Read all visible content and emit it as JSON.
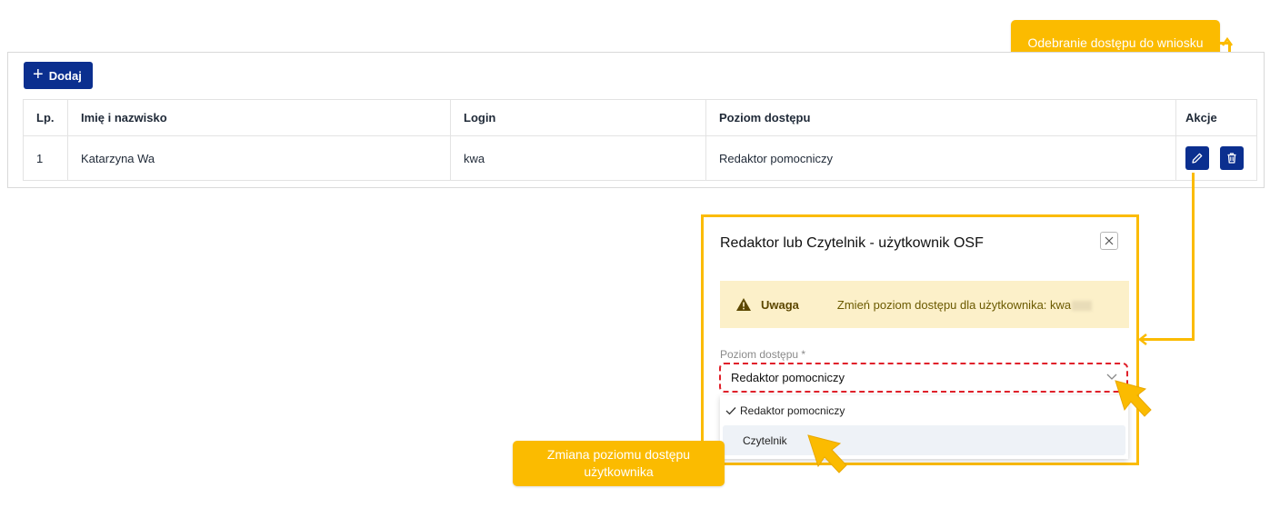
{
  "toolbar": {
    "add_label": "Dodaj"
  },
  "table": {
    "headers": {
      "lp": "Lp.",
      "name": "Imię i nazwisko",
      "login": "Login",
      "level": "Poziom dostępu",
      "actions": "Akcje"
    },
    "rows": [
      {
        "lp": "1",
        "name": "Katarzyna Wa",
        "login": "kwa",
        "level": "Redaktor pomocniczy"
      }
    ]
  },
  "callouts": {
    "remove_access": "Odebranie dostępu do wniosku",
    "change_level": "Zmiana poziomu dostępu użytkownika"
  },
  "modal": {
    "title": "Redaktor lub Czytelnik - użytkownik OSF",
    "alert_title": "Uwaga",
    "alert_message": "Zmień poziom dostępu dla użytkownika: kwa",
    "field_label": "Poziom dostępu *",
    "selected_value": "Redaktor pomocniczy",
    "options": [
      "Redaktor pomocniczy",
      "Czytelnik"
    ]
  },
  "colors": {
    "primary": "#0b2f8f",
    "highlight": "#fbbb00",
    "alert_bg": "#fcf0c9",
    "dashed_border": "#e0202a"
  }
}
